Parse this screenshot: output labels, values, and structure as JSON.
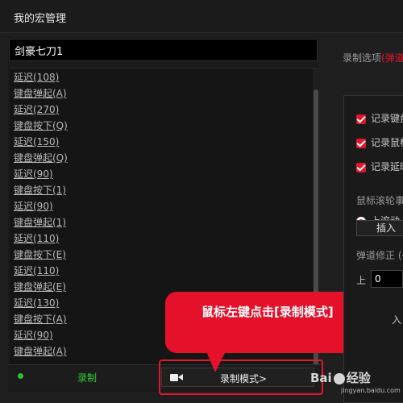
{
  "window": {
    "title": "我的宏管理"
  },
  "macro_name": {
    "value": "剑豪七刀1"
  },
  "events": [
    "延迟(108)",
    "键盘弹起(A)",
    "延迟(270)",
    "键盘按下(Q)",
    "延迟(150)",
    "键盘弹起(Q)",
    "延迟(90)",
    "键盘按下(1)",
    "延迟(90)",
    "键盘弹起(1)",
    "延迟(110)",
    "键盘按下(E)",
    "延迟(110)",
    "键盘弹起(E)",
    "延迟(130)",
    "键盘按下(A)",
    "延迟(90)",
    "键盘弹起(A)"
  ],
  "bottom_bar": {
    "record_label": "录制",
    "mode_button_label": "录制模式>"
  },
  "callout": {
    "text": "鼠标左键点击[录制模式]"
  },
  "right_panel": {
    "options_label": "录制选项",
    "options_accent": "(弹道",
    "checkboxes": [
      "记录键盘",
      "记录鼠标",
      "记录延时"
    ],
    "wheel_label": "鼠标滚轮事",
    "radio_label": "上滚动",
    "insert_label": "插入",
    "trajectory_label": "弹道修正 (←",
    "up_label": "上",
    "up_value": "0",
    "partial_label": "入"
  },
  "watermark": {
    "text": "Bai",
    "text2": "经验",
    "sub": "jingyan.baidu.com"
  },
  "colors": {
    "accent": "#e0162b",
    "record_green": "#2ed12e",
    "background": "#1f1f1f"
  }
}
